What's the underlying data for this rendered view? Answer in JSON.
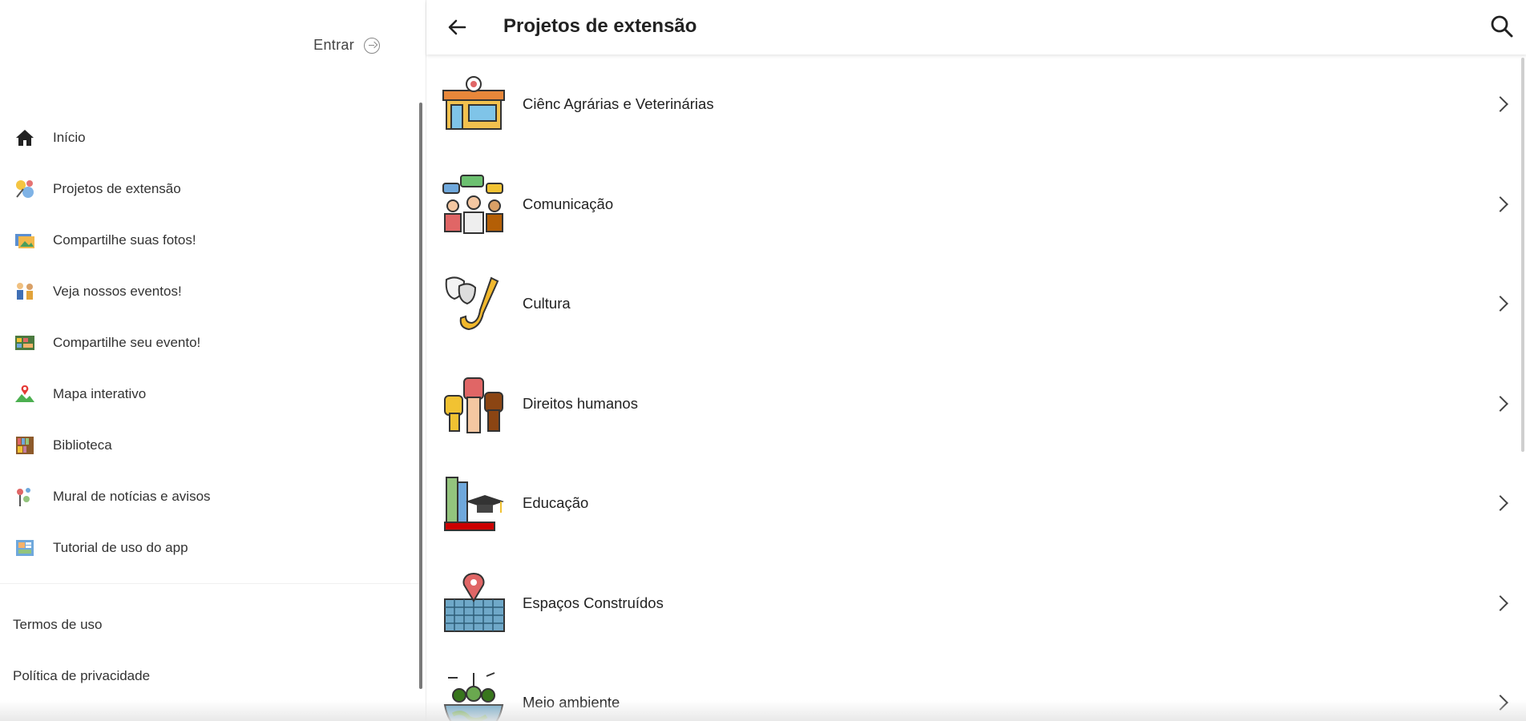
{
  "sidebar": {
    "login_label": "Entrar",
    "items": [
      {
        "label": "Início",
        "icon": "home-icon"
      },
      {
        "label": "Projetos de extensão",
        "icon": "projects-icon"
      },
      {
        "label": "Compartilhe suas fotos!",
        "icon": "photos-icon"
      },
      {
        "label": "Veja nossos eventos!",
        "icon": "events-icon"
      },
      {
        "label": "Compartilhe seu evento!",
        "icon": "share-event-icon"
      },
      {
        "label": "Mapa interativo",
        "icon": "map-icon"
      },
      {
        "label": "Biblioteca",
        "icon": "library-icon"
      },
      {
        "label": "Mural de notícias e avisos",
        "icon": "news-icon"
      },
      {
        "label": "Tutorial de uso do app",
        "icon": "tutorial-icon"
      }
    ],
    "footer": {
      "terms": "Termos de uso",
      "privacy": "Política de privacidade"
    }
  },
  "main": {
    "title": "Projetos de extensão",
    "categories": [
      {
        "label": "Ciênc Agrárias e Veterinárias",
        "icon": "agrarian-store-icon"
      },
      {
        "label": "Comunicação",
        "icon": "communication-people-icon"
      },
      {
        "label": "Cultura",
        "icon": "culture-masks-saxophone-icon"
      },
      {
        "label": "Direitos humanos",
        "icon": "human-rights-fists-icon"
      },
      {
        "label": "Educação",
        "icon": "education-books-cap-icon"
      },
      {
        "label": "Espaços Construídos",
        "icon": "built-spaces-map-pin-icon"
      },
      {
        "label": "Meio ambiente",
        "icon": "environment-plants-icon"
      }
    ]
  },
  "colors": {
    "accent_text": "#222222",
    "divider": "#ececec",
    "scrollbar": "#7a7a7a"
  }
}
